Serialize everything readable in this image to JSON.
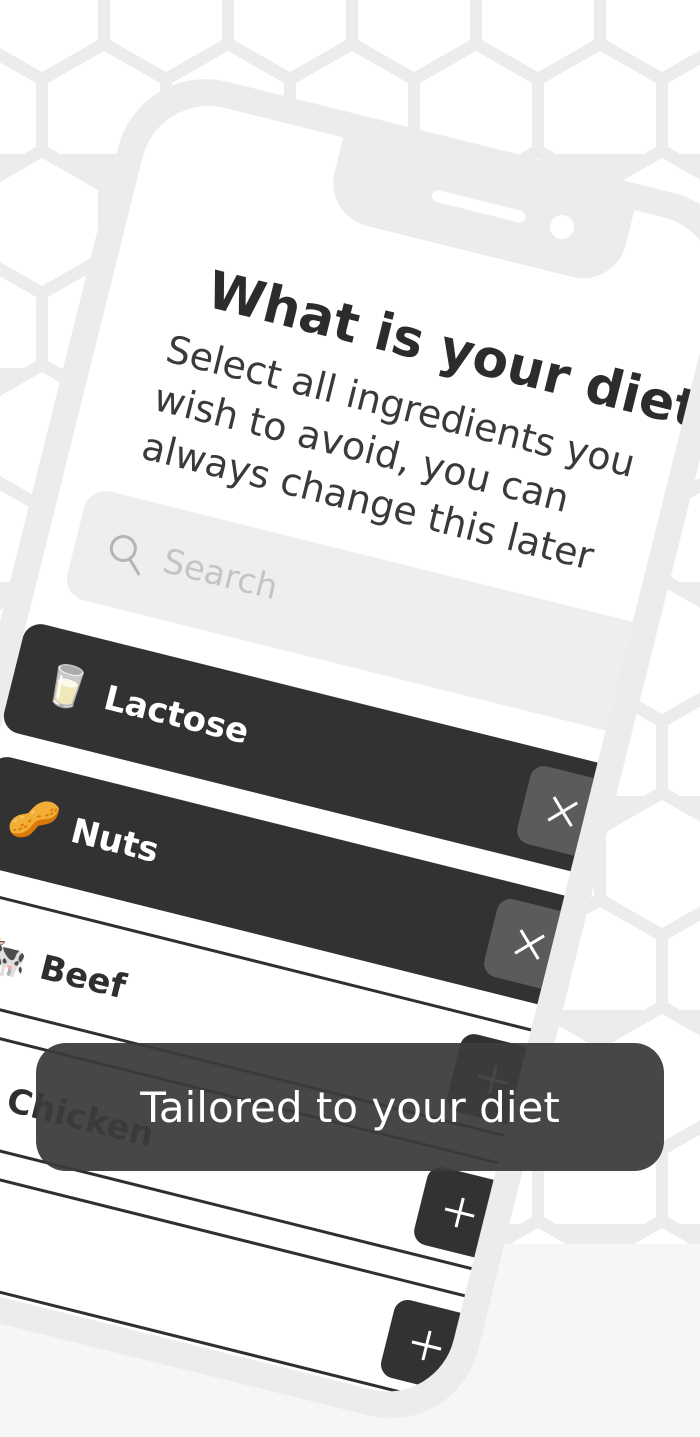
{
  "screen": {
    "title": "What is your diet?",
    "subtitle": "Select all ingredients you wish to avoid, you can always change this later"
  },
  "search": {
    "placeholder": "Search",
    "icon": "search-icon"
  },
  "ingredients": [
    {
      "emoji": "🥛",
      "label": "Lactose",
      "selected": true,
      "action": "remove"
    },
    {
      "emoji": "🥜",
      "label": "Nuts",
      "selected": true,
      "action": "remove"
    },
    {
      "emoji": "🐄",
      "label": "Beef",
      "selected": false,
      "action": "add"
    },
    {
      "emoji": "",
      "label": "Chicken",
      "selected": false,
      "action": "add"
    },
    {
      "emoji": "",
      "label": "",
      "selected": false,
      "action": "add"
    }
  ],
  "caption": {
    "text": "Tailored to your diet"
  },
  "colors": {
    "background": "#f6f6f6",
    "phone_frame": "#ececee",
    "selected_item": "#323232",
    "selected_button": "#5b5b5b",
    "caption_bg": "#3c3c3c"
  }
}
